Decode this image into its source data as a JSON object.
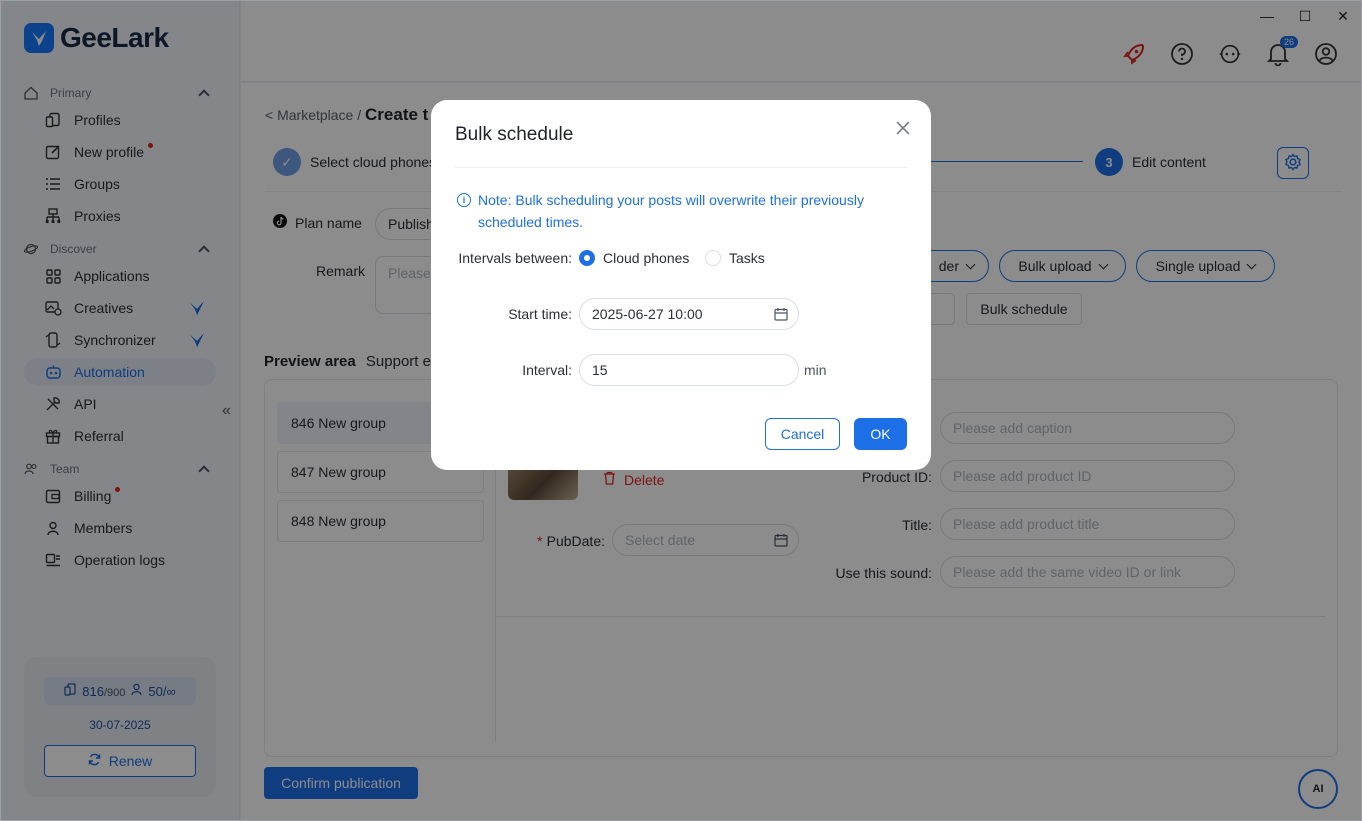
{
  "app": {
    "name": "GeeLark"
  },
  "sidebar": {
    "sections": [
      {
        "label": "Primary"
      },
      {
        "label": "Discover"
      },
      {
        "label": "Team"
      }
    ],
    "items": [
      {
        "label": "Profiles"
      },
      {
        "label": "New profile"
      },
      {
        "label": "Groups"
      },
      {
        "label": "Proxies"
      },
      {
        "label": "Applications"
      },
      {
        "label": "Creatives"
      },
      {
        "label": "Synchronizer"
      },
      {
        "label": "Automation"
      },
      {
        "label": "API"
      },
      {
        "label": "Referral"
      },
      {
        "label": "Billing"
      },
      {
        "label": "Members"
      },
      {
        "label": "Operation logs"
      }
    ],
    "account": {
      "profiles_used": "816",
      "profiles_total": "/900",
      "members_used": "50/",
      "members_total": "∞",
      "expiry": "30-07-2025",
      "renew_label": "Renew"
    }
  },
  "topbar": {
    "notification_count": "26"
  },
  "page": {
    "breadcrumb_parent": "Marketplace",
    "breadcrumb_sep": "/",
    "breadcrumb_current": "Create t",
    "steps": [
      {
        "label": "Select cloud phones"
      },
      {
        "num": "3",
        "label": "Edit content"
      }
    ],
    "plan_name_label": "Plan name",
    "plan_name_value": "Publish",
    "remark_label": "Remark",
    "remark_placeholder": "Please e",
    "buttons": {
      "order": "der",
      "bulk_upload": "Bulk upload",
      "single_upload": "Single upload",
      "bulk_schedule": "Bulk schedule"
    },
    "preview": {
      "title": "Preview area",
      "subtitle": "Support e",
      "groups": [
        "846 New group",
        "847 New group",
        "848 New group"
      ],
      "delete_label": "Delete",
      "fields": {
        "caption_placeholder": "Please add caption",
        "product_id_label": "Product ID:",
        "product_id_placeholder": "Please add product ID",
        "title_label": "Title:",
        "title_placeholder": "Please add product title",
        "sound_label": "Use this sound:",
        "sound_placeholder": "Please add the same video ID or link",
        "pubdate_required": "*",
        "pubdate_label": "PubDate:",
        "pubdate_placeholder": "Select date"
      }
    },
    "confirm_label": "Confirm publication",
    "ai_label": "AI"
  },
  "modal": {
    "title": "Bulk schedule",
    "note": "Note: Bulk scheduling your posts will overwrite their previously scheduled times.",
    "intervals_label": "Intervals between:",
    "options": [
      "Cloud phones",
      "Tasks"
    ],
    "selected_option": "Cloud phones",
    "start_time_label": "Start time:",
    "start_time_value": "2025-06-27 10:00",
    "interval_label": "Interval:",
    "interval_value": "15",
    "interval_unit": "min",
    "cancel_label": "Cancel",
    "ok_label": "OK"
  },
  "colors": {
    "accent": "#1d6fe8",
    "danger": "#e02424"
  }
}
